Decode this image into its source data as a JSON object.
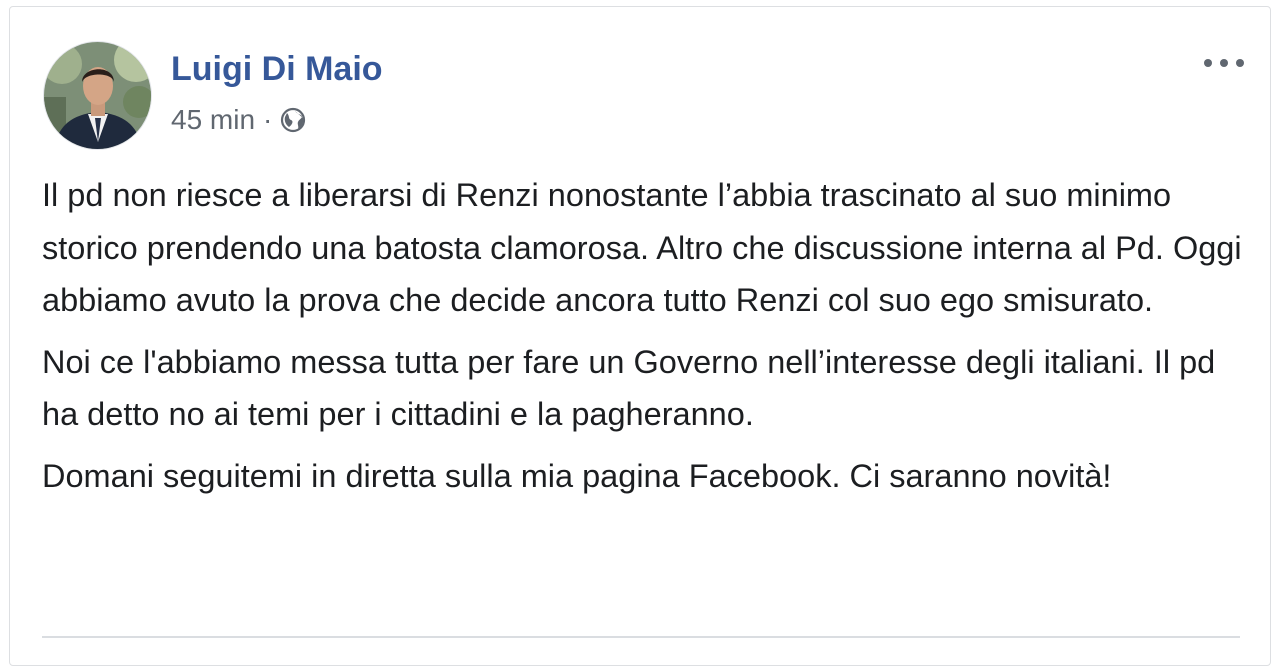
{
  "post": {
    "author": "Luigi Di Maio",
    "time": "45 min",
    "separator": "·",
    "audience_icon": "globe-icon",
    "more_icon": "more-options-icon",
    "paragraphs": [
      "Il pd non riesce a liberarsi di Renzi nonostante l’abbia trascinato al suo minimo storico prendendo una batosta clamorosa. Altro che discussione interna al Pd. Oggi abbiamo avuto la prova che decide ancora tutto Renzi col suo ego smisurato.",
      "Noi ce l'abbiamo messa tutta per fare un Governo nell’interesse degli italiani. Il pd ha detto no ai temi per i cittadini e la pagheranno.",
      "Domani seguitemi in diretta sulla mia pagina Facebook. Ci saranno novità!"
    ]
  },
  "colors": {
    "author_link": "#365899",
    "meta_text": "#606770",
    "body_text": "#1c1e21",
    "border": "#dddfe2"
  }
}
